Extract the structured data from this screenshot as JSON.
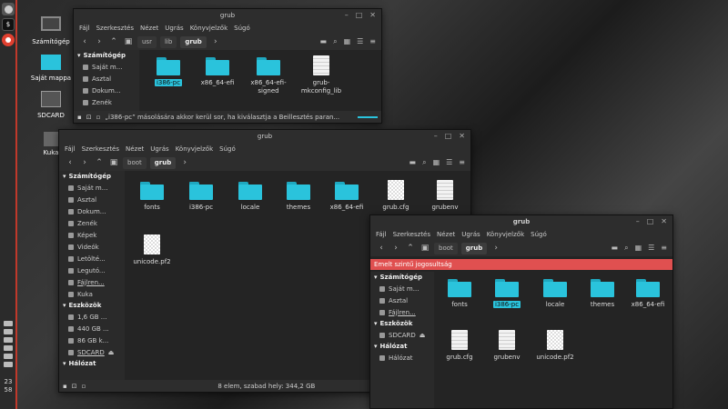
{
  "desktop": {
    "icons": [
      {
        "label": "Számítógép"
      },
      {
        "label": "Saját mappa"
      },
      {
        "label": "SDCARD"
      },
      {
        "label": "Kuka"
      }
    ]
  },
  "panel": {
    "clock_hour": "23",
    "clock_min": "58"
  },
  "menu": [
    "Fájl",
    "Szerkesztés",
    "Nézet",
    "Ugrás",
    "Könyvjelzők",
    "Súgó"
  ],
  "win1": {
    "title": "grub",
    "crumbs": [
      "usr",
      "lib",
      "grub"
    ],
    "sidebar": {
      "head": "Számítógép",
      "items": [
        "Saját m...",
        "Asztal",
        "Dokum...",
        "Zenék"
      ]
    },
    "files": [
      {
        "name": "i386-pc",
        "type": "folder"
      },
      {
        "name": "x86_64-efi",
        "type": "folder"
      },
      {
        "name": "x86_64-efi-signed",
        "type": "folder"
      },
      {
        "name": "grub-mkconfig_lib",
        "type": "doc"
      }
    ],
    "status": "„i386-pc” másolására akkor kerül sor, ha kiválasztja a Beillesztés paran..."
  },
  "win2": {
    "title": "grub",
    "crumbs": [
      "boot",
      "grub"
    ],
    "sidebar": {
      "head1": "Számítógép",
      "items1": [
        "Saját m...",
        "Asztal",
        "Dokum...",
        "Zenék",
        "Képek",
        "Videók",
        "Letölté...",
        "Legutó...",
        "Fájlren...",
        "Kuka"
      ],
      "head2": "Eszközök",
      "items2": [
        "1,6 GB ...",
        "440 GB ...",
        "86 GB k...",
        "SDCARD"
      ],
      "head3": "Hálózat"
    },
    "files": [
      "fonts",
      "i386-pc",
      "locale",
      "themes",
      "x86_64-efi",
      "grub.cfg",
      "grubenv",
      "unicode.pf2"
    ],
    "status": "8 elem, szabad hely: 344,2 GB"
  },
  "win3": {
    "title": "grub",
    "crumbs": [
      "boot",
      "grub"
    ],
    "warning": "Emelt szintű jogosultság",
    "sidebar": {
      "head1": "Számítógép",
      "items1": [
        "Saját m...",
        "Asztal",
        "Fájlren..."
      ],
      "head2": "Eszközök",
      "items2": [
        "SDCARD"
      ],
      "head3": "Hálózat",
      "items3": [
        "Hálózat"
      ]
    },
    "files": [
      "fonts",
      "i386-pc",
      "locale",
      "themes",
      "x86_64-efi",
      "grub.cfg",
      "grubenv",
      "unicode.pf2"
    ]
  }
}
